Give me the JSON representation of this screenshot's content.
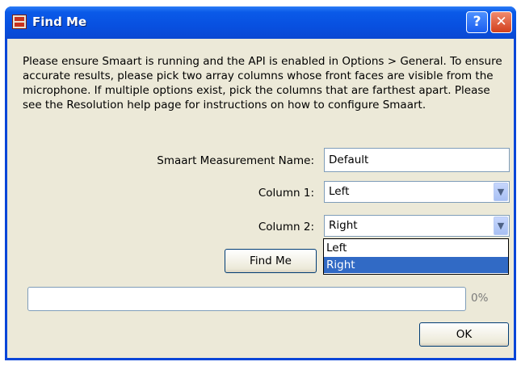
{
  "window": {
    "title": "Find Me",
    "title_icon": "smaart-app-icon",
    "help_glyph": "?",
    "close_glyph": "✕"
  },
  "instructions": "Please ensure Smaart is running and the API is enabled in Options > General. To ensure accurate results, please pick two array columns whose front faces are visible from the microphone. If multiple options exist, pick the columns that are farthest apart. Please see the Resolution help page for instructions on how to configure Smaart.",
  "form": {
    "measurement_label": "Smaart Measurement Name:",
    "measurement_value": "Default",
    "column1_label": "Column 1:",
    "column1_value": "Left",
    "column2_label": "Column 2:",
    "column2_value": "Right",
    "dropdown_arrow": "▼",
    "column2_options": [
      "Left",
      "Right"
    ],
    "column2_highlighted": "Right"
  },
  "buttons": {
    "find_me": "Find Me",
    "ok": "OK"
  },
  "progress": {
    "fraction": 0,
    "label": "0%"
  }
}
